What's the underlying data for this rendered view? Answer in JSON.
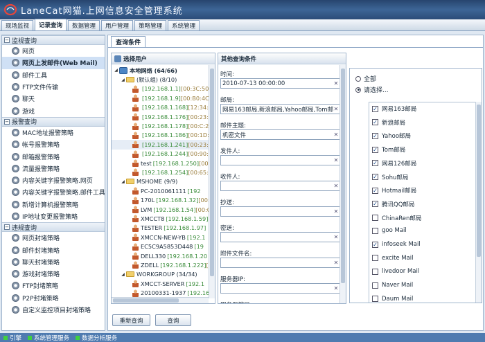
{
  "app": {
    "title": "LaneCat网猫.上网信息安全管理系统"
  },
  "menu": {
    "tabs": [
      {
        "label": "现场监视"
      },
      {
        "label": "记录查询",
        "active": true
      },
      {
        "label": "数据管理"
      },
      {
        "label": "用户管理"
      },
      {
        "label": "策略管理"
      },
      {
        "label": "系统管理"
      }
    ]
  },
  "sidebar": {
    "groups": [
      {
        "title": "监视查询",
        "items": [
          "网页",
          "网页上发邮件(Web Mail)",
          "邮件工具",
          "FTP文件传输",
          "聊天",
          "游戏"
        ],
        "selected": 1
      },
      {
        "title": "报警查询",
        "items": [
          "MAC地址报警策略",
          "帐号报警策略",
          "邮箱报警策略",
          "流量报警策略",
          "内容关键字报警策略.网页",
          "内容关键字报警策略.邮件工具",
          "新增计算机报警策略",
          "IP地址变更报警策略"
        ]
      },
      {
        "title": "违规查询",
        "items": [
          "网页封堵策略",
          "邮件封堵策略",
          "聊天封堵策略",
          "游戏封堵策略",
          "FTP封堵策略",
          "P2P封堵策略",
          "自定义监控项目封堵策略"
        ]
      }
    ]
  },
  "main": {
    "tab_label": "查询条件",
    "user_panel": {
      "title": "选择用户",
      "root": "本地网络 (64/66)",
      "groups": [
        {
          "name": "(默认组) (8/10)",
          "users": [
            {
              "name": "",
              "ip": "[192.168.1.1]",
              "mac": "[00:3C:50"
            },
            {
              "name": "",
              "ip": "[192.168.1.9]",
              "mac": "[00:B0:4C"
            },
            {
              "name": "",
              "ip": "[192.168.1.168]",
              "mac": "[12:34:5"
            },
            {
              "name": "",
              "ip": "[192.168.1.176]",
              "mac": "[00:23:7"
            },
            {
              "name": "",
              "ip": "[192.168.1.178]",
              "mac": "[00:C:2"
            },
            {
              "name": "",
              "ip": "[192.168.1.186]",
              "mac": "[00:1D:F"
            },
            {
              "name": "",
              "ip": "[192.168.1.241]",
              "mac": "[00:23:7"
            },
            {
              "name": "",
              "ip": "[192.168.1.244]",
              "mac": "[00:90:0"
            },
            {
              "name": "test",
              "ip": "[192.168.1.250]",
              "mac": "[00:"
            },
            {
              "name": "",
              "ip": "[192.168.1.254]",
              "mac": "[00:65:5"
            }
          ]
        },
        {
          "name": "MSHOME (9/9)",
          "users": [
            {
              "name": "PC-2010061111",
              "ip": "[192",
              "mac": ""
            },
            {
              "name": "170L",
              "ip": "[192.168.1.32]",
              "mac": "[00:"
            },
            {
              "name": "LVM",
              "ip": "[192.168.1.54]",
              "mac": "[00:0"
            },
            {
              "name": "XMCCT8",
              "ip": "[192.168.1.59]",
              "mac": ""
            },
            {
              "name": "TESTER",
              "ip": "[192.168.1.97]",
              "mac": ""
            },
            {
              "name": "XMCCN-NEW-YB",
              "ip": "[192.1",
              "mac": ""
            },
            {
              "name": "EC5C9A5853D448",
              "ip": "[19",
              "mac": ""
            },
            {
              "name": "DELL330",
              "ip": "[192.168.1.20",
              "mac": ""
            },
            {
              "name": "ZDELL",
              "ip": "[192.168.1.222]",
              "mac": "["
            }
          ]
        },
        {
          "name": "WORKGROUP (34/34)",
          "users": [
            {
              "name": "XMCCT-SERVER",
              "ip": "[192.1",
              "mac": ""
            },
            {
              "name": "20100331-1937",
              "ip": "[192.16",
              "mac": ""
            }
          ]
        }
      ]
    },
    "conditions": {
      "title": "其他查询条件",
      "fields": [
        {
          "label": "时间:",
          "value": "2010-07-13 00:00:00"
        },
        {
          "label": "邮局:",
          "value": "网易163邮局,新浪邮局,Yahoo邮局,Tom邮"
        },
        {
          "label": "邮件主题:",
          "value": "机密文件"
        },
        {
          "label": "发件人:",
          "value": ""
        },
        {
          "label": "收件人:",
          "value": ""
        },
        {
          "label": "抄送:",
          "value": ""
        },
        {
          "label": "密送:",
          "value": ""
        },
        {
          "label": "附件文件名:",
          "value": ""
        },
        {
          "label": "服务器IP:",
          "value": ""
        },
        {
          "label": "服务器端口:",
          "value": ""
        }
      ]
    },
    "options": {
      "radio_all": "全部",
      "radio_select": "请选择...",
      "selected_radio": "select",
      "mailboxes": [
        {
          "label": "网易163邮局",
          "checked": true
        },
        {
          "label": "新浪邮局",
          "checked": true
        },
        {
          "label": "Yahoo邮局",
          "checked": true
        },
        {
          "label": "Tom邮局",
          "checked": true
        },
        {
          "label": "网易126邮局",
          "checked": true
        },
        {
          "label": "Sohu邮局",
          "checked": true
        },
        {
          "label": "Hotmail邮局",
          "checked": true
        },
        {
          "label": "腾讯QQ邮局",
          "checked": true
        },
        {
          "label": "ChinaRen邮局",
          "checked": false
        },
        {
          "label": "goo Mail",
          "checked": false
        },
        {
          "label": "infoseek Mail",
          "checked": true
        },
        {
          "label": "excite Mail",
          "checked": false
        },
        {
          "label": "livedoor Mail",
          "checked": false
        },
        {
          "label": "Naver Mail",
          "checked": false
        },
        {
          "label": "Daum Mail",
          "checked": false
        }
      ]
    },
    "buttons": {
      "reset": "重新查询",
      "query": "查询"
    }
  },
  "statusbar": {
    "items": [
      "引擎",
      "系统管理服务",
      "数据分析服务"
    ]
  },
  "colors": {
    "titlebar": "#2f5282",
    "statusbar": "#4f7bb0",
    "status_ok": "#40d040",
    "selected_row": "#cfe0f5"
  }
}
